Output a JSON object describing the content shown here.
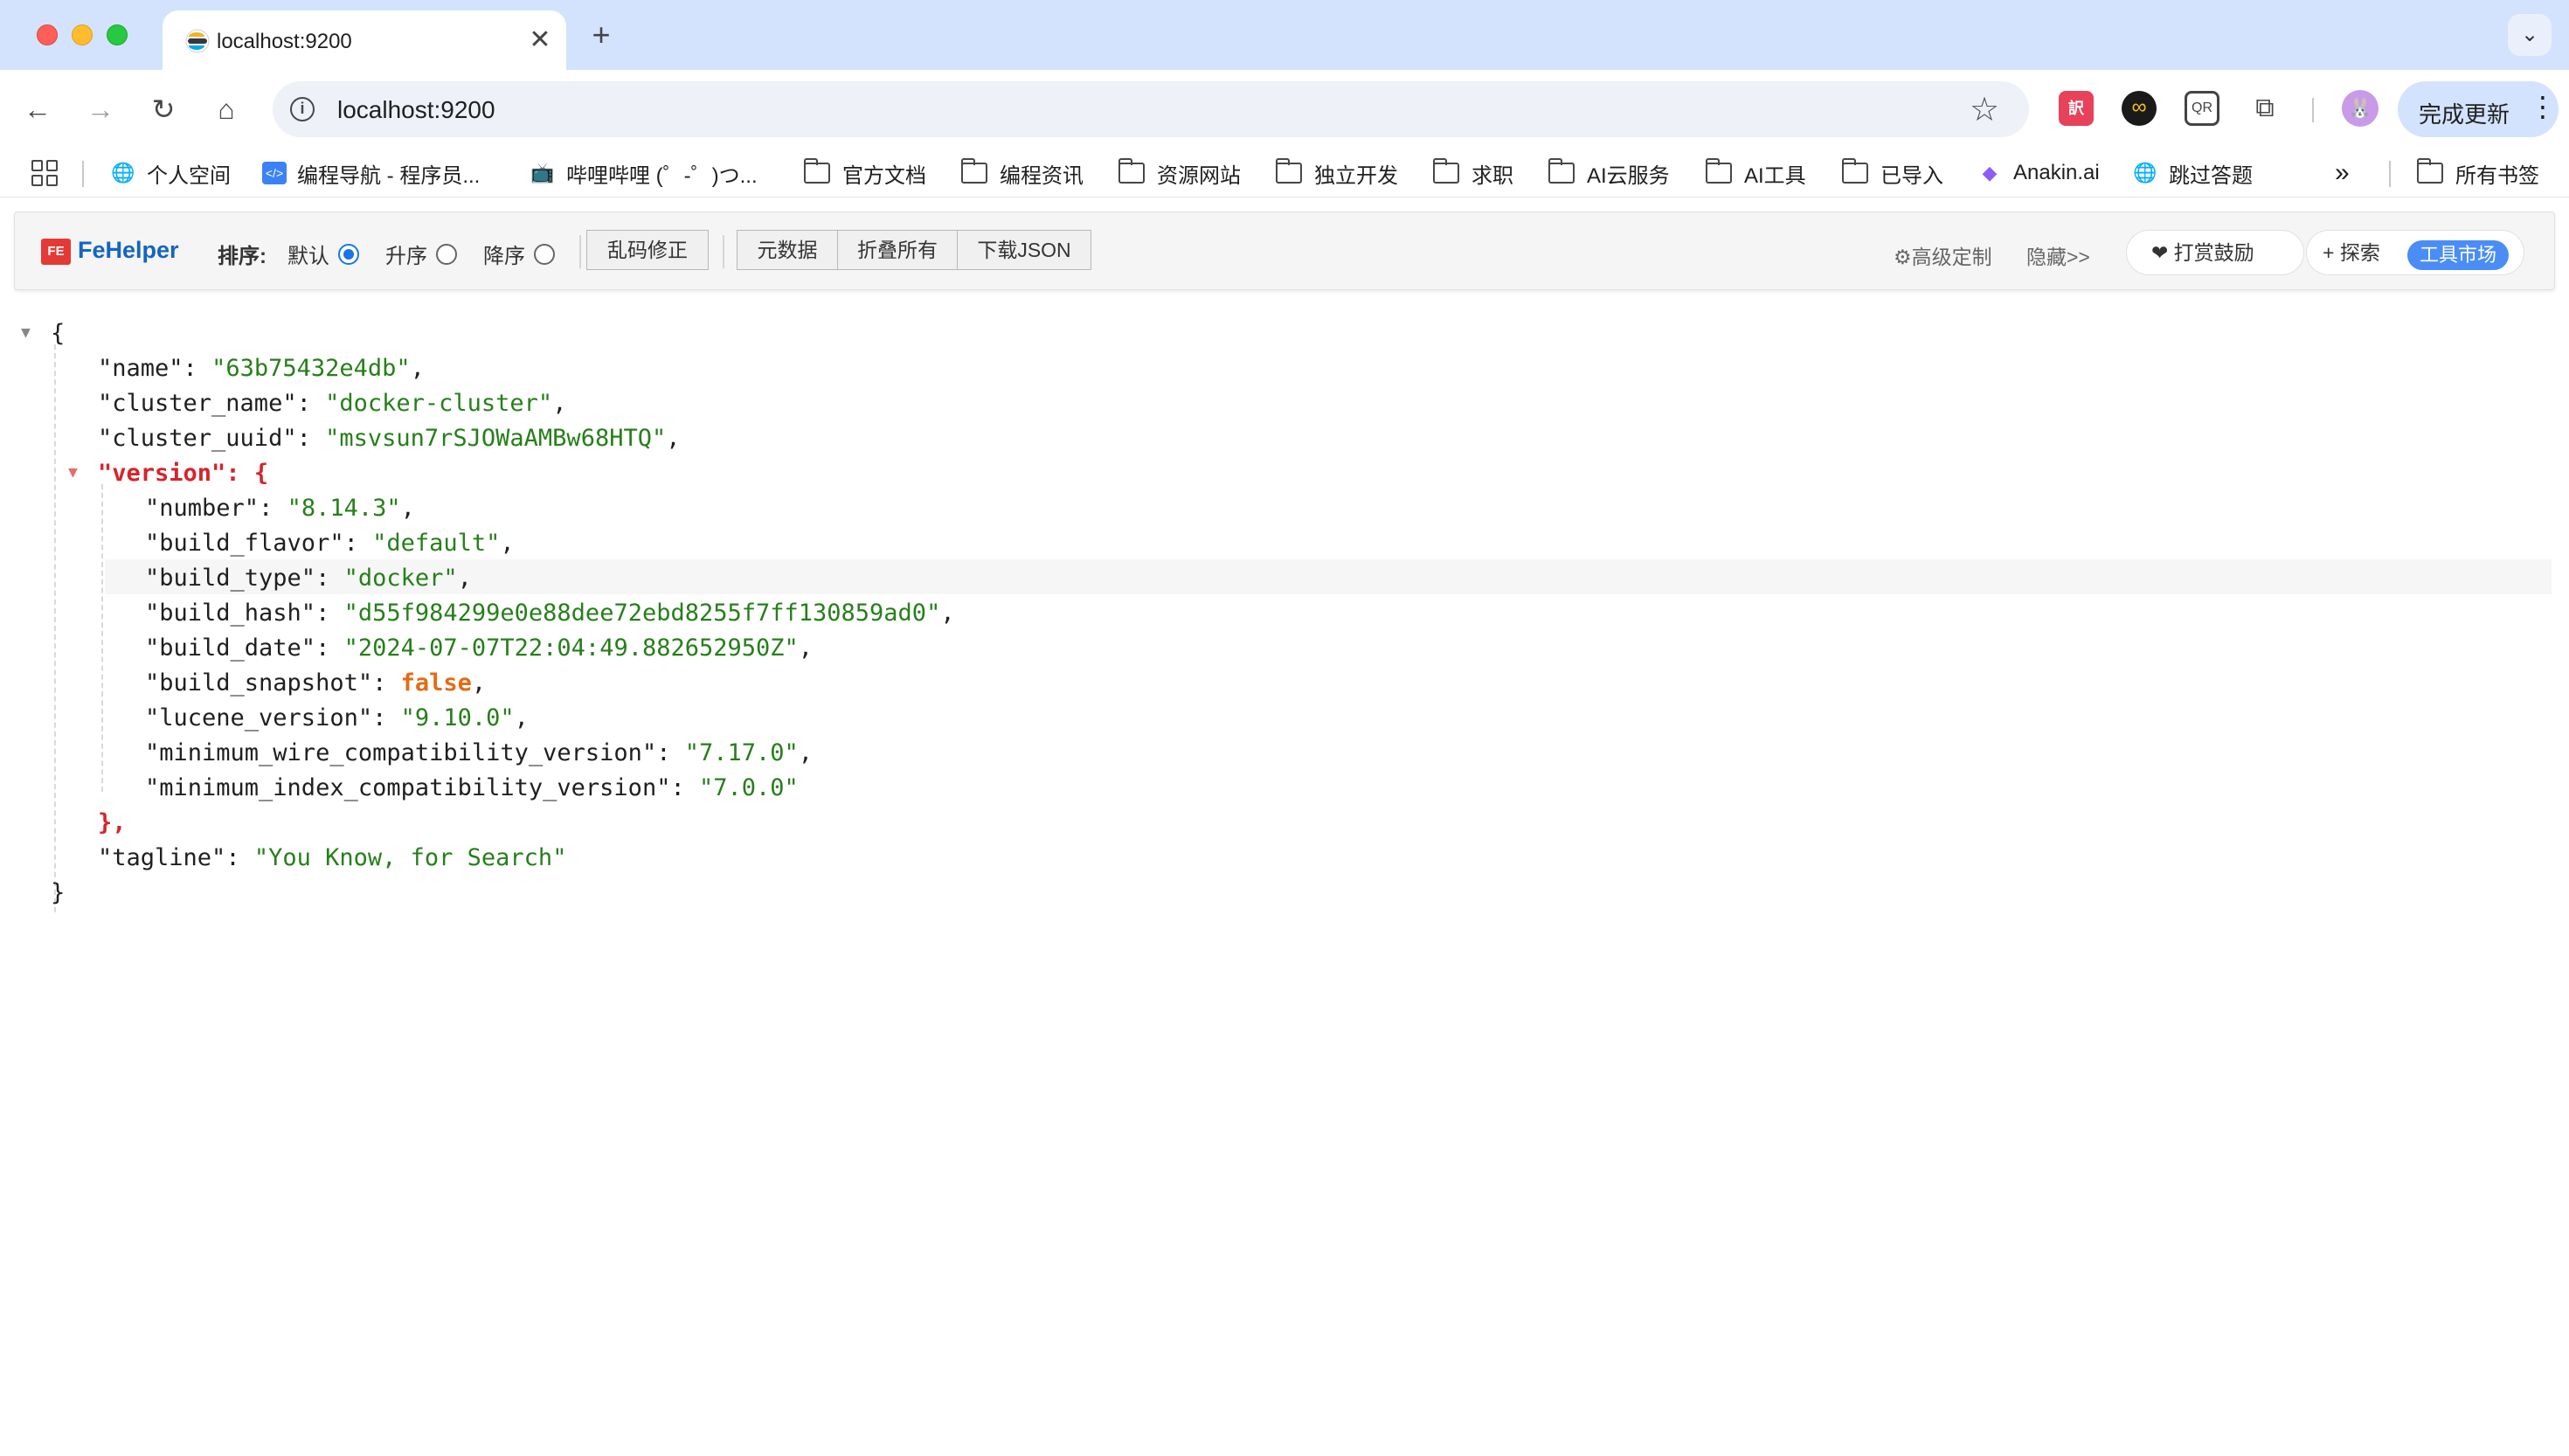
{
  "browser": {
    "tab": {
      "title": "localhost:9200",
      "close": "✕"
    },
    "new_tab": "+",
    "tab_search": "⌄",
    "nav": {
      "back": "←",
      "forward": "→",
      "reload": "↻",
      "home": "⌂"
    },
    "address": {
      "info": "i",
      "url": "localhost:9200",
      "star": "☆"
    },
    "extensions": {
      "translate": "訳",
      "infinity": "∞",
      "qr": "QR",
      "puzzle": "⧉"
    },
    "avatar": "🐰",
    "update_button": {
      "label": "完成更新",
      "menu": "⋮"
    }
  },
  "bookmarks": {
    "items": [
      {
        "label": "个人空间",
        "icon": "globe-icon"
      },
      {
        "label": "编程导航 - 程序员...",
        "icon": "code-icon"
      },
      {
        "label": "哔哩哔哩 (゜-゜)つ...",
        "icon": "bilibili-icon"
      },
      {
        "label": "官方文档",
        "icon": "folder-icon"
      },
      {
        "label": "编程资讯",
        "icon": "folder-icon"
      },
      {
        "label": "资源网站",
        "icon": "folder-icon"
      },
      {
        "label": "独立开发",
        "icon": "folder-icon"
      },
      {
        "label": "求职",
        "icon": "folder-icon"
      },
      {
        "label": "AI云服务",
        "icon": "folder-icon"
      },
      {
        "label": "AI工具",
        "icon": "folder-icon"
      },
      {
        "label": "已导入",
        "icon": "folder-icon"
      },
      {
        "label": "Anakin.ai",
        "icon": "anakin-icon"
      },
      {
        "label": "跳过答题",
        "icon": "globe-icon"
      }
    ],
    "overflow": "»",
    "all_bookmarks": "所有书签"
  },
  "fehelper": {
    "title": "FeHelper",
    "logo": "FE",
    "sort_label": "排序:",
    "sort_options": [
      {
        "label": "默认",
        "selected": true
      },
      {
        "label": "升序",
        "selected": false
      },
      {
        "label": "降序",
        "selected": false
      }
    ],
    "fix_encoding": "乱码修正",
    "buttons": [
      "元数据",
      "折叠所有",
      "下载JSON"
    ],
    "advanced": "⚙高级定制",
    "hide": "隐藏>>",
    "donate": "❤ 打赏鼓励",
    "explore": "+ 探索",
    "market": "工具市场"
  },
  "json": {
    "open_brace": "{",
    "close_brace": "}",
    "fields": [
      {
        "key": "\"name\"",
        "value": "\"63b75432e4db\""
      },
      {
        "key": "\"cluster_name\"",
        "value": "\"docker-cluster\""
      },
      {
        "key": "\"cluster_uuid\"",
        "value": "\"msvsun7rSJOWaAMBw68HTQ\""
      }
    ],
    "version_key": "\"version\"",
    "version_fields": [
      {
        "key": "\"number\"",
        "value": "\"8.14.3\""
      },
      {
        "key": "\"build_flavor\"",
        "value": "\"default\""
      },
      {
        "key": "\"build_type\"",
        "value": "\"docker\""
      },
      {
        "key": "\"build_hash\"",
        "value": "\"d55f984299e0e88dee72ebd8255f7ff130859ad0\""
      },
      {
        "key": "\"build_date\"",
        "value": "\"2024-07-07T22:04:49.882652950Z\""
      },
      {
        "key": "\"build_snapshot\"",
        "value": "false"
      },
      {
        "key": "\"lucene_version\"",
        "value": "\"9.10.0\""
      },
      {
        "key": "\"minimum_wire_compatibility_version\"",
        "value": "\"7.17.0\""
      },
      {
        "key": "\"minimum_index_compatibility_version\"",
        "value": "\"7.0.0\""
      }
    ],
    "version_close": "},",
    "tagline_key": "\"tagline\"",
    "tagline_value": "\"You Know, for Search\"",
    "collapse_toggle": "▼"
  }
}
